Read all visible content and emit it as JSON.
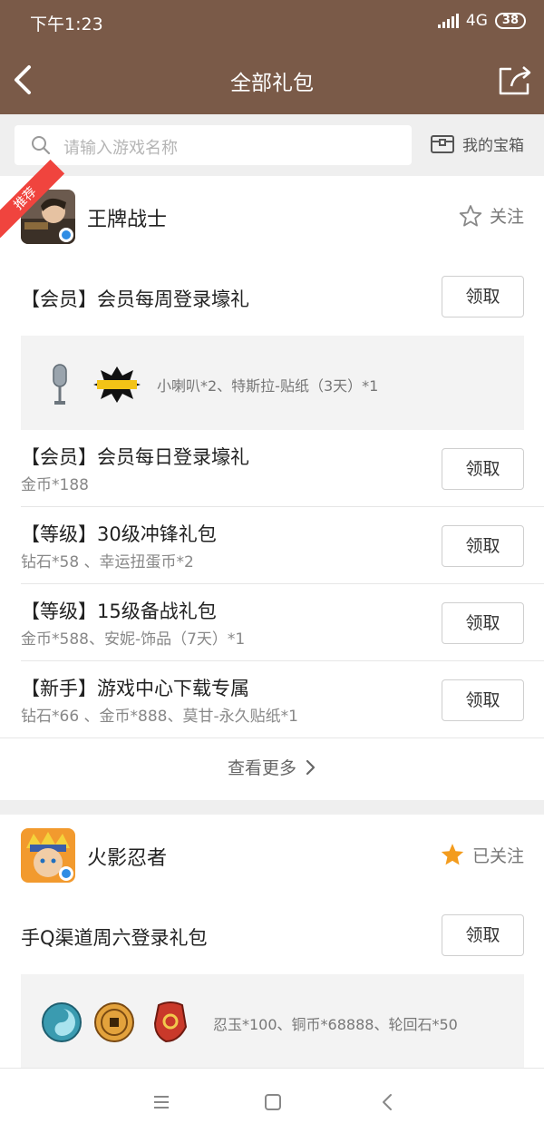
{
  "status_bar": {
    "time": "下午1:23",
    "network": "4G",
    "battery": "38"
  },
  "nav": {
    "title": "全部礼包"
  },
  "search": {
    "placeholder": "请输入游戏名称",
    "treasure_label": "我的宝箱"
  },
  "games": [
    {
      "name": "王牌战士",
      "badge": "推荐",
      "follow_label": "关注",
      "followed": false,
      "packages": [
        {
          "title": "【会员】会员每周登录壕礼",
          "claim_label": "领取",
          "rewards": "小喇叭*2、特斯拉-贴纸（3天）*1"
        },
        {
          "title": "【会员】会员每日登录壕礼",
          "sub": "金币*188",
          "claim_label": "领取"
        },
        {
          "title": "【等级】30级冲锋礼包",
          "sub": "钻石*58 、幸运扭蛋币*2",
          "claim_label": "领取"
        },
        {
          "title": "【等级】15级备战礼包",
          "sub": "金币*588、安妮-饰品（7天）*1",
          "claim_label": "领取"
        },
        {
          "title": "【新手】游戏中心下载专属",
          "sub": "钻石*66 、金币*888、莫甘-永久贴纸*1",
          "claim_label": "领取"
        }
      ],
      "more_label": "查看更多"
    },
    {
      "name": "火影忍者",
      "follow_label": "已关注",
      "followed": true,
      "packages": [
        {
          "title": "手Q渠道周六登录礼包",
          "claim_label": "领取",
          "rewards": "忍玉*100、铜币*68888、轮回石*50"
        }
      ]
    }
  ],
  "colors": {
    "header": "#7a5a48",
    "ribbon": "#f0443e",
    "star_active": "#f39c1e"
  }
}
